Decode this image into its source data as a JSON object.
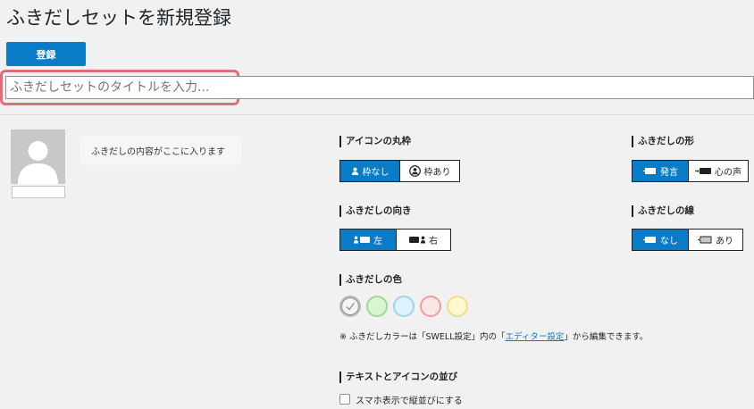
{
  "page": {
    "title": "ふきだしセットを新規登録"
  },
  "toolbar": {
    "register_label": "登録"
  },
  "title_field": {
    "placeholder": "ふきだしセットのタイトルを入力..."
  },
  "preview": {
    "balloon_text": "ふきだしの内容がここに入ります"
  },
  "icon_frame": {
    "label": "アイコンの丸枠",
    "options": [
      "枠なし",
      "枠あり"
    ],
    "selected": "枠なし"
  },
  "direction": {
    "label": "ふきだしの向き",
    "options": [
      "左",
      "右"
    ],
    "selected": "左"
  },
  "shape": {
    "label": "ふきだしの形",
    "options": [
      "発言",
      "心の声"
    ],
    "selected": "発言"
  },
  "border": {
    "label": "ふきだしの線",
    "options": [
      "なし",
      "あり"
    ],
    "selected": "なし"
  },
  "color": {
    "label": "ふきだしの色",
    "swatches": [
      {
        "name": "default",
        "fill": "#f4f4f4",
        "stroke": "#bbbbbb",
        "selected": true
      },
      {
        "name": "green",
        "fill": "#d9f6d0",
        "stroke": "#9fd98f"
      },
      {
        "name": "blue",
        "fill": "#def3fc",
        "stroke": "#9fd2ec"
      },
      {
        "name": "red",
        "fill": "#fde6e6",
        "stroke": "#ef9d9d"
      },
      {
        "name": "yellow",
        "fill": "#fff8d1",
        "stroke": "#f0dc91"
      }
    ],
    "note_prefix": "※ ふきだしカラーは「SWELL設定」内の「",
    "note_link": "エディター設定",
    "note_suffix": "」から編集できます。"
  },
  "layout_order": {
    "label": "テキストとアイコンの並び",
    "checkbox_label": "スマホ表示で縦並びにする"
  }
}
